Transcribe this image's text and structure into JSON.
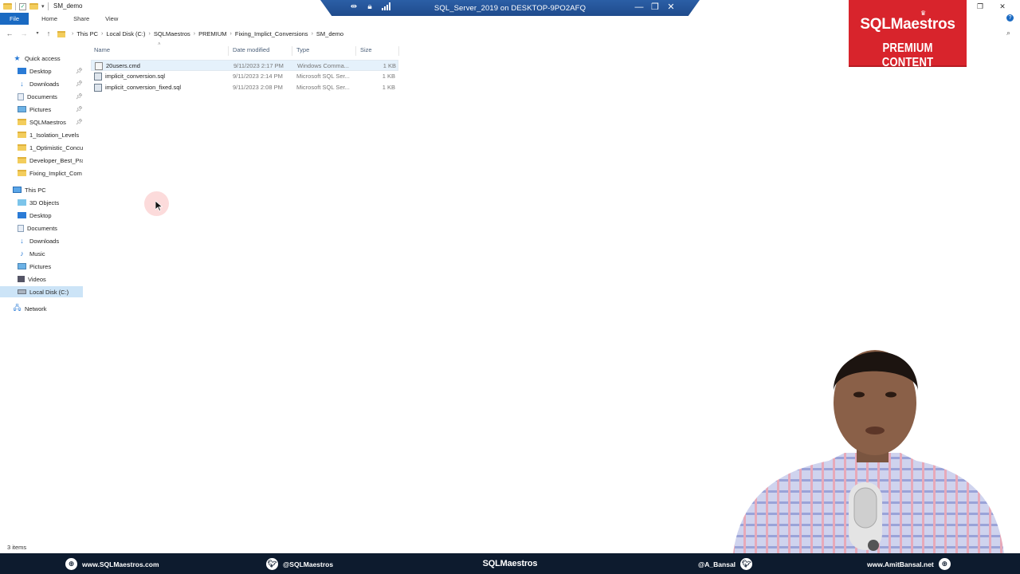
{
  "window": {
    "title": "SM_demo",
    "controls": [
      "—",
      "❐",
      "✕"
    ]
  },
  "remote": {
    "title": "SQL_Server_2019 on DESKTOP-9PO2AFQ"
  },
  "ribbon": {
    "tabs": [
      "File",
      "Home",
      "Share",
      "View"
    ]
  },
  "address": {
    "crumbs": [
      "This PC",
      "Local Disk (C:)",
      "SQLMaestros",
      "PREMIUM",
      "Fixing_Implict_Conversions",
      "SM_demo"
    ]
  },
  "nav_pane": {
    "quick_access": "Quick access",
    "quick_items": [
      {
        "label": "Desktop",
        "icon": "desktop-icon",
        "pinned": true
      },
      {
        "label": "Downloads",
        "icon": "download-icon",
        "pinned": true
      },
      {
        "label": "Documents",
        "icon": "documents-icon",
        "pinned": true
      },
      {
        "label": "Pictures",
        "icon": "pictures-icon",
        "pinned": true
      },
      {
        "label": "SQLMaestros",
        "icon": "folder-icon",
        "pinned": true
      },
      {
        "label": "1_Isolation_Levels",
        "icon": "folder-icon",
        "pinned": false
      },
      {
        "label": "1_Optimistic_Concu",
        "icon": "folder-icon",
        "pinned": false
      },
      {
        "label": "Developer_Best_Pra",
        "icon": "folder-icon",
        "pinned": false
      },
      {
        "label": "Fixing_Implict_Com",
        "icon": "folder-icon",
        "pinned": false
      }
    ],
    "this_pc": "This PC",
    "pc_items": [
      {
        "label": "3D Objects",
        "icon": "3d-objects-icon"
      },
      {
        "label": "Desktop",
        "icon": "desktop-icon"
      },
      {
        "label": "Documents",
        "icon": "documents-icon"
      },
      {
        "label": "Downloads",
        "icon": "download-icon"
      },
      {
        "label": "Music",
        "icon": "music-icon"
      },
      {
        "label": "Pictures",
        "icon": "pictures-icon"
      },
      {
        "label": "Videos",
        "icon": "videos-icon"
      },
      {
        "label": "Local Disk (C:)",
        "icon": "drive-icon",
        "selected": true
      }
    ],
    "network": "Network"
  },
  "file_list": {
    "columns": {
      "name": "Name",
      "date": "Date modified",
      "type": "Type",
      "size": "Size"
    },
    "rows": [
      {
        "name": "20users.cmd",
        "date": "9/11/2023 2:17 PM",
        "type": "Windows Comma...",
        "size": "1 KB",
        "icon": "cmd-file-icon"
      },
      {
        "name": "implicit_conversion.sql",
        "date": "9/11/2023 2:14 PM",
        "type": "Microsoft SQL Ser...",
        "size": "1 KB",
        "icon": "sql-file-icon"
      },
      {
        "name": "implicit_conversion_fixed.sql",
        "date": "9/11/2023 2:08 PM",
        "type": "Microsoft SQL Ser...",
        "size": "1 KB",
        "icon": "sql-file-icon"
      }
    ]
  },
  "status": {
    "items_count": "3 items"
  },
  "badge": {
    "line1": "SQLMaestros",
    "line2": "PREMIUM CONTENT",
    "color": "#d8242c"
  },
  "footer": {
    "website": "www.SQLMaestros.com",
    "twitter1": "@SQLMaestros",
    "brand": "SQLMaestros",
    "twitter2": "@A_Bansal",
    "website2": "www.AmitBansal.net",
    "background": "#0d1b2e"
  }
}
